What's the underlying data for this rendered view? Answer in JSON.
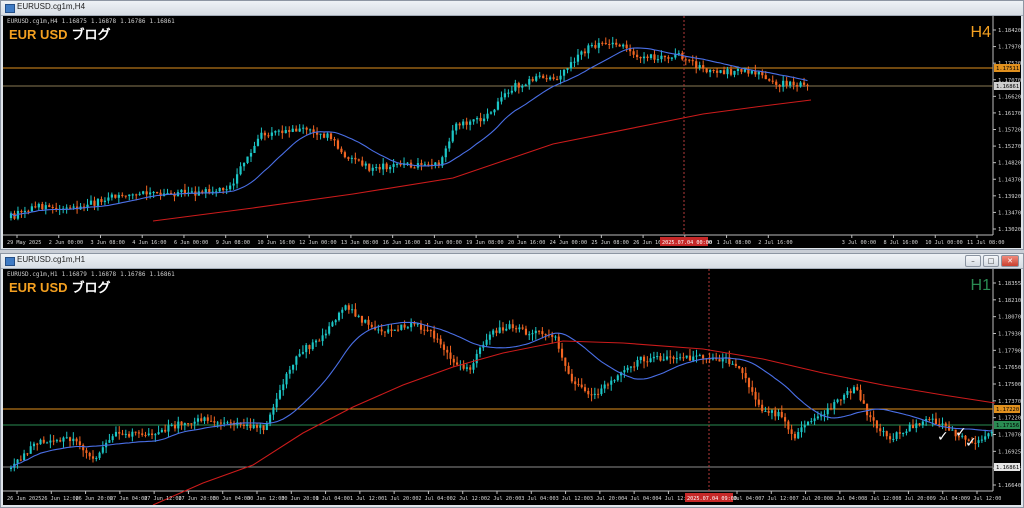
{
  "windows": [
    {
      "title": "EURUSD.cg1m,H4",
      "info": {
        "symbol": "EURUSD.cg1m,H4",
        "o": "1.16875",
        "h": "1.16878",
        "l": "1.16786",
        "c": "1.16861"
      },
      "blog_brand": "EUR USD",
      "blog_jp": "ブログ",
      "timeframe": "H4",
      "timeframe_color": "#f4a020",
      "price_labels": [
        "1.18420",
        "1.17970",
        "1.17520",
        "1.17070",
        "1.16620",
        "1.16170",
        "1.15720",
        "1.15270",
        "1.14820",
        "1.14370",
        "1.13920",
        "1.13470",
        "1.13020"
      ],
      "hline_orange": "1.17511",
      "bid_label": "1.16861",
      "date_labels": [
        "29 May 2025",
        "2 Jun 00:00",
        "3 Jun 08:00",
        "4 Jun 16:00",
        "6 Jun 00:00",
        "9 Jun 08:00",
        "10 Jun 16:00",
        "12 Jun 00:00",
        "13 Jun 08:00",
        "16 Jun 16:00",
        "18 Jun 00:00",
        "19 Jun 08:00",
        "20 Jun 16:00",
        "24 Jun 00:00",
        "25 Jun 08:00",
        "26 Jun 16:00",
        "30 Jun 00:00",
        "1 Jul 08:00",
        "2 Jul 16:00",
        "",
        "3 Jul 00:00",
        "8 Jul 16:00",
        "10 Jul 00:00",
        "11 Jul 08:00"
      ],
      "cursor_date": "2025.07.04 00:00",
      "chart_data": {
        "type": "candlestick",
        "ma_fast_color": "#4a6fe6",
        "ma_slow_color": "#cc1b1b",
        "up_color": "#1cc6c6",
        "down_color": "#f26522"
      }
    },
    {
      "title": "EURUSD.cg1m,H1",
      "info": {
        "symbol": "EURUSD.cg1m,H1",
        "o": "1.16879",
        "h": "1.16878",
        "l": "1.16786",
        "c": "1.16861"
      },
      "blog_brand": "EUR USD",
      "blog_jp": "ブログ",
      "timeframe": "H1",
      "timeframe_color": "#2a8b52",
      "price_labels": [
        "1.18355",
        "1.18210",
        "1.18070",
        "1.17930",
        "1.17790",
        "1.17650",
        "1.17500",
        "1.17370",
        "1.17220",
        "1.17070",
        "1.16925",
        "1.16785",
        "1.16640"
      ],
      "hline_orange": "1.17220",
      "bid_label": "1.17156",
      "bid_color": "#2a8b52",
      "hline_grey": "1.16861",
      "date_labels": [
        "26 Jun 2025",
        "26 Jun 12:00",
        "26 Jun 20:00",
        "27 Jun 04:00",
        "27 Jun 12:00",
        "27 Jun 20:00",
        "30 Jun 04:00",
        "30 Jun 12:00",
        "30 Jun 20:00",
        "1 Jul 04:00",
        "1 Jul 12:00",
        "1 Jul 20:00",
        "2 Jul 04:00",
        "2 Jul 12:00",
        "2 Jul 20:00",
        "3 Jul 04:00",
        "3 Jul 12:00",
        "3 Jul 20:00",
        "4 Jul 04:00",
        "4 Jul 12:00",
        "",
        "7 Jul 04:00",
        "7 Jul 12:00",
        "7 Jul 20:00",
        "8 Jul 04:00",
        "8 Jul 12:00",
        "8 Jul 20:00",
        "9 Jul 04:00",
        "9 Jul 12:00"
      ],
      "cursor_date": "2025.07.04 09:00",
      "checkmarks": [
        "✓",
        "✓",
        "✓"
      ],
      "chart_data": {
        "type": "candlestick",
        "ma_fast_color": "#4a6fe6",
        "ma_slow_color": "#cc1b1b",
        "up_color": "#1cc6c6",
        "down_color": "#f26522"
      }
    }
  ]
}
